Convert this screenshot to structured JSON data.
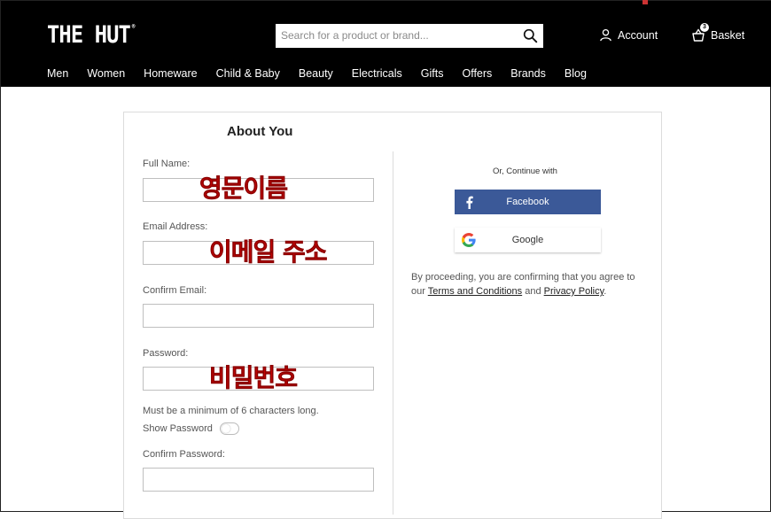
{
  "header": {
    "logo": "THE HUT",
    "logo_mark": "®",
    "search_placeholder": "Search for a product or brand...",
    "account_label": "Account",
    "basket_label": "Basket",
    "basket_count": "3"
  },
  "nav": {
    "items": [
      "Men",
      "Women",
      "Homeware",
      "Child & Baby",
      "Beauty",
      "Electricals",
      "Gifts",
      "Offers",
      "Brands",
      "Blog"
    ]
  },
  "form": {
    "title": "About You",
    "full_name_label": "Full Name:",
    "email_label": "Email Address:",
    "confirm_email_label": "Confirm Email:",
    "password_label": "Password:",
    "password_hint": "Must be a minimum of 6 characters long.",
    "show_password_label": "Show Password",
    "confirm_password_label": "Confirm Password:"
  },
  "annotations": {
    "full_name": "영문이름",
    "email": "이메일 주소",
    "password": "비밀번호"
  },
  "social": {
    "or_continue": "Or, Continue with",
    "facebook_label": "Facebook",
    "google_label": "Google",
    "legal_prefix": "By proceeding, you are confirming that you agree to our ",
    "terms_label": "Terms and Conditions",
    "legal_and": " and ",
    "privacy_label": "Privacy Policy",
    "legal_suffix": "."
  },
  "colors": {
    "header_bg": "#000000",
    "facebook_blue": "#3b5998",
    "annotation_red": "#d60000"
  }
}
